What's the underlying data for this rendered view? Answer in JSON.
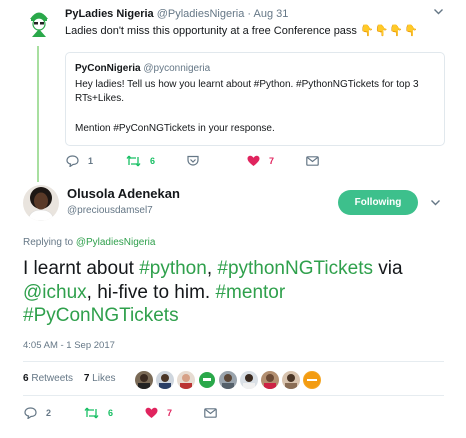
{
  "original_tweet": {
    "name": "PyLadies Nigeria",
    "handle": "@PyladiesNigeria",
    "separator": "·",
    "date": "Aug 31",
    "text": "Ladies don't miss this opportunity at a free Conference pass",
    "emoji": "👇👇👇👇",
    "quoted": {
      "name": "PyConNigeria",
      "handle": "@pyconnigeria",
      "text": "Hey ladies! Tell us how you learnt about #Python. #PythonNGTickets for top 3 RTs+Likes.",
      "text2": "Mention #PyConNGTickets in your response."
    },
    "actions": {
      "replies": "1",
      "retweets": "6",
      "likes": "7"
    }
  },
  "main_tweet": {
    "name": "Olusola Adenekan",
    "handle": "@preciousdamsel7",
    "follow_label": "Following",
    "replying_prefix": "Replying to",
    "replying_to": "@PyladiesNigeria",
    "body": {
      "t1": "I learnt about ",
      "h1": "#python",
      "t2": ", ",
      "h2": "#pythonNGTickets",
      "t3": " via ",
      "m1": "@ichux",
      "t4": ", hi-five to him. ",
      "h3": "#mentor",
      "h4": "#PyConNGTickets"
    },
    "timestamp": "4:05 AM - 1 Sep 2017",
    "stats": {
      "retweets": "6",
      "retweets_label": "Retweets",
      "likes": "7",
      "likes_label": "Likes"
    },
    "actions": {
      "replies": "2",
      "retweets": "6",
      "likes": "7"
    }
  },
  "colors": {
    "accent": "#2fa04c",
    "follow_button": "#3dc08c",
    "like_heart": "#e0245e",
    "retweet": "#17bf63",
    "muted": "#657786"
  }
}
